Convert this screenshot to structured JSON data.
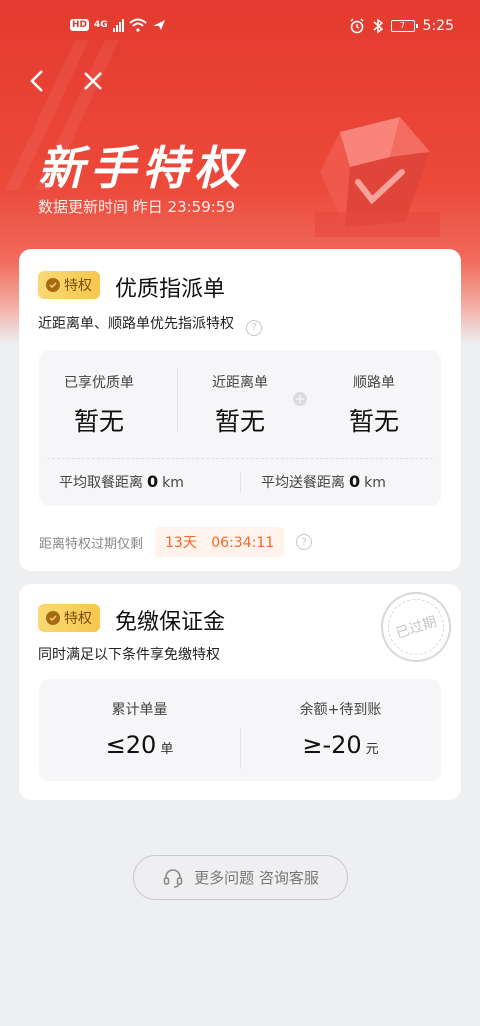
{
  "status_bar": {
    "network": "4G",
    "battery": "7",
    "time": "5:25"
  },
  "header": {
    "title": "新手特权",
    "subtitle": "数据更新时间 昨日 23:59:59"
  },
  "privilege1": {
    "badge": "特权",
    "title": "优质指派单",
    "desc": "近距离单、顺路单优先指派特权",
    "stats": [
      {
        "label": "已享优质单",
        "value": "暂无"
      },
      {
        "label": "近距离单",
        "value": "暂无"
      },
      {
        "label": "顺路单",
        "value": "暂无"
      }
    ],
    "pickup_label": "平均取餐距离",
    "pickup_value": "0",
    "pickup_unit": "km",
    "delivery_label": "平均送餐距离",
    "delivery_value": "0",
    "delivery_unit": "km",
    "expire_label": "距离特权过期仅剩",
    "expire_timer": "13天 06:34:11"
  },
  "privilege2": {
    "badge": "特权",
    "title": "免缴保证金",
    "desc": "同时满足以下条件享免缴特权",
    "stamp": "已过期",
    "cond1_label": "累计单量",
    "cond1_value": "≤20",
    "cond1_unit": "单",
    "cond2_label": "余额+待到账",
    "cond2_value": "≥-20",
    "cond2_unit": "元"
  },
  "help_button": "更多问题 咨询客服",
  "colors": {
    "brand_red": "#e43a2f",
    "badge_gold": "#f5c84e",
    "timer_orange": "#ee6b2d"
  }
}
